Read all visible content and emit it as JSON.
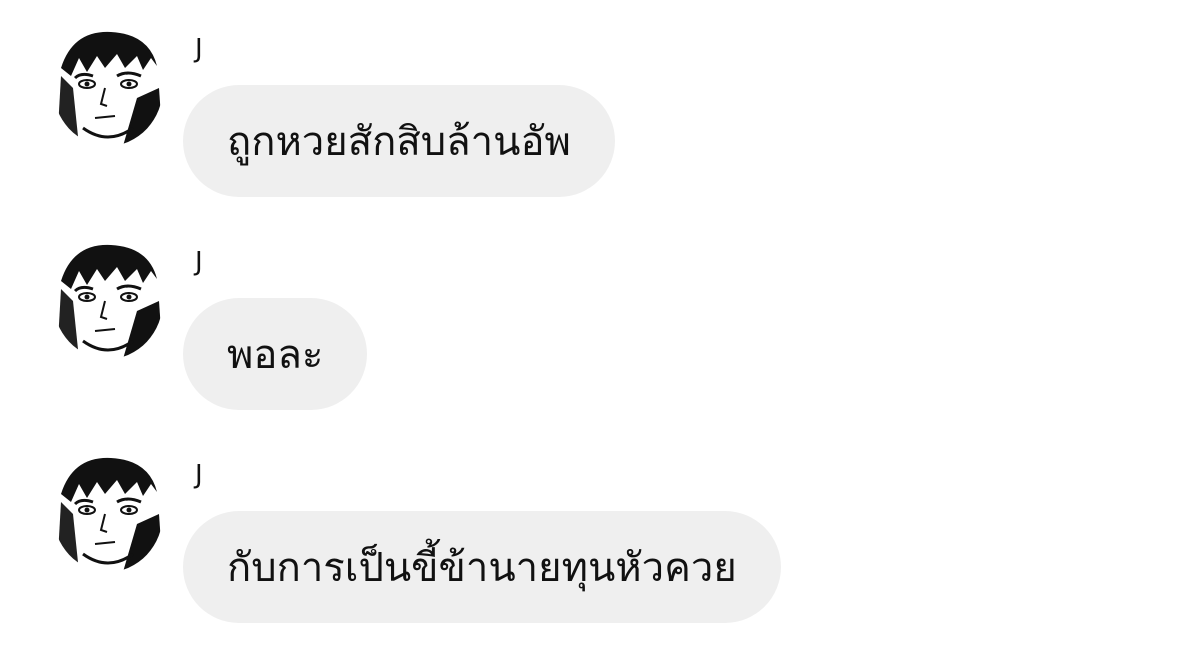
{
  "messages": [
    {
      "sender": "J",
      "text": "ถูกหวยสักสิบล้านอัพ",
      "avatar_icon": "user-avatar-icon"
    },
    {
      "sender": "J",
      "text": "พอละ",
      "avatar_icon": "user-avatar-icon"
    },
    {
      "sender": "J",
      "text": "กับการเป็นขี้ข้านายทุนหัวควย",
      "avatar_icon": "user-avatar-icon"
    }
  ],
  "colors": {
    "background": "#ffffff",
    "bubble": "#efefef",
    "text": "#111111"
  }
}
